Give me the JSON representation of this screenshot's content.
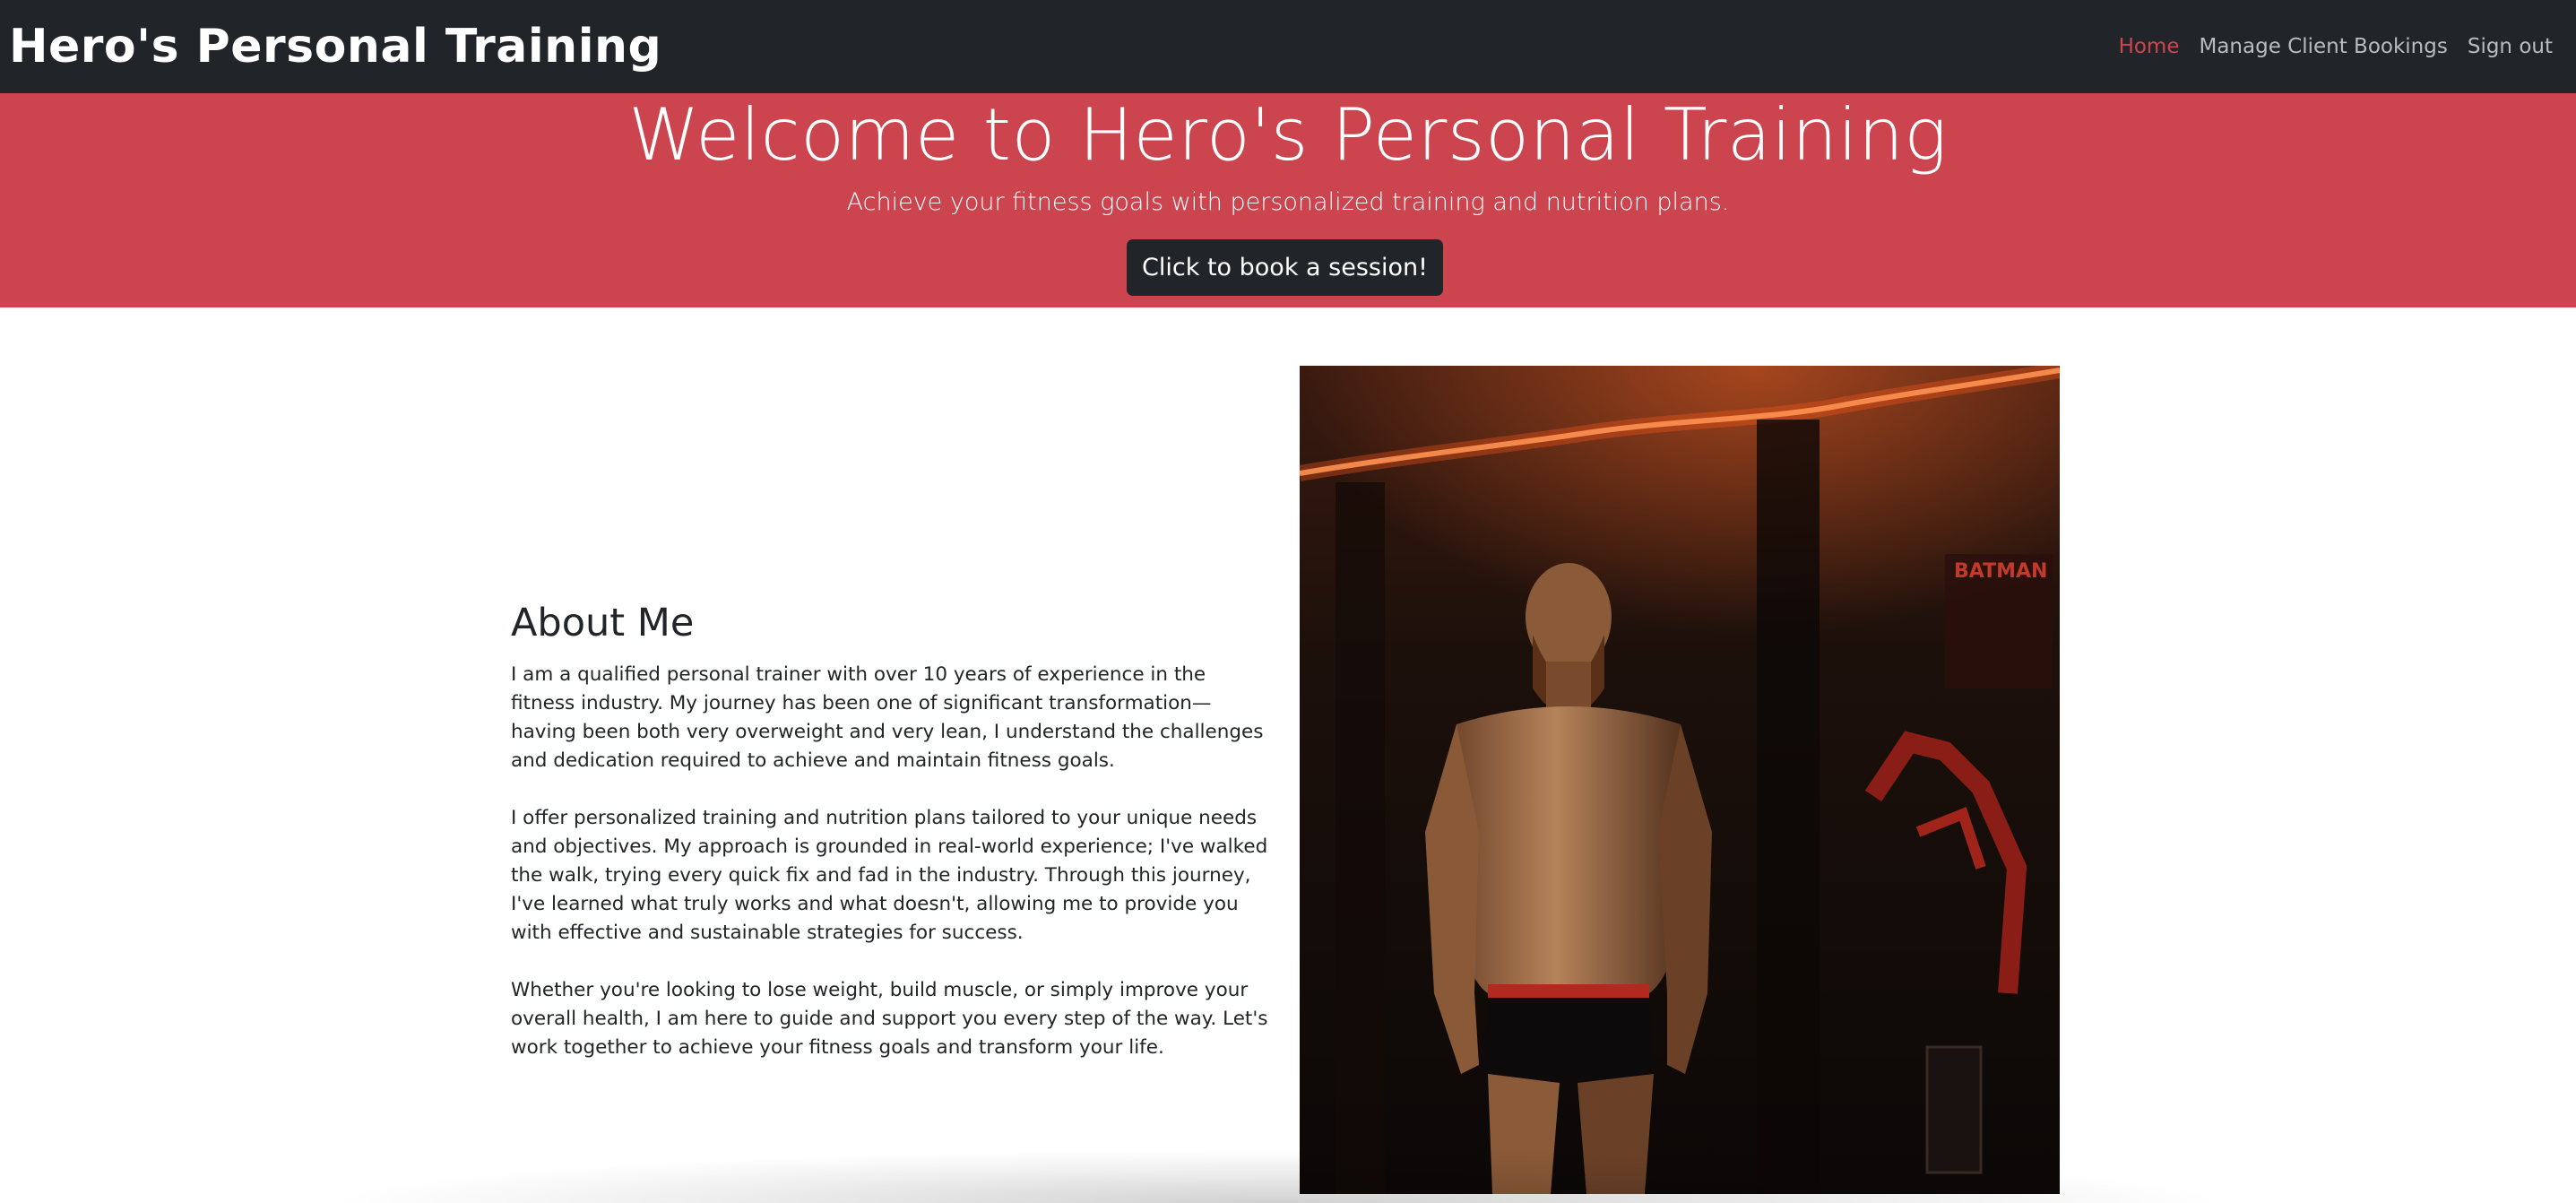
{
  "navbar": {
    "brand": "Hero's Personal Training",
    "links": [
      {
        "label": "Home",
        "active": true
      },
      {
        "label": "Manage Client Bookings",
        "active": false
      },
      {
        "label": "Sign out",
        "active": false
      }
    ]
  },
  "hero": {
    "title": "Welcome to Hero's Personal Training",
    "subtitle": "Achieve your fitness goals with personalized training and nutrition plans.",
    "cta_label": "Click to book a session!"
  },
  "about": {
    "title": "About Me",
    "paragraphs": [
      "I am a qualified personal trainer with over 10 years of experience in the fitness industry. My journey has been one of significant transformation—having been both very overweight and very lean, I understand the challenges and dedication required to achieve and maintain fitness goals.",
      "I offer personalized training and nutrition plans tailored to your unique needs and objectives. My approach is grounded in real-world experience; I've walked the walk, trying every quick fix and fad in the industry. Through this journey, I've learned what truly works and what doesn't, allowing me to provide you with effective and sustainable strategies for success.",
      "Whether you're looking to lose weight, build muscle, or simply improve your overall health, I am here to guide and support you every step of the way. Let's work together to achieve your fitness goals and transform your life."
    ]
  },
  "photo": {
    "poster_text": "BATMAN"
  },
  "colors": {
    "navbar_bg": "#212529",
    "hero_bg": "#cc444e",
    "active_link": "#ce4550",
    "button_bg": "#212529"
  }
}
